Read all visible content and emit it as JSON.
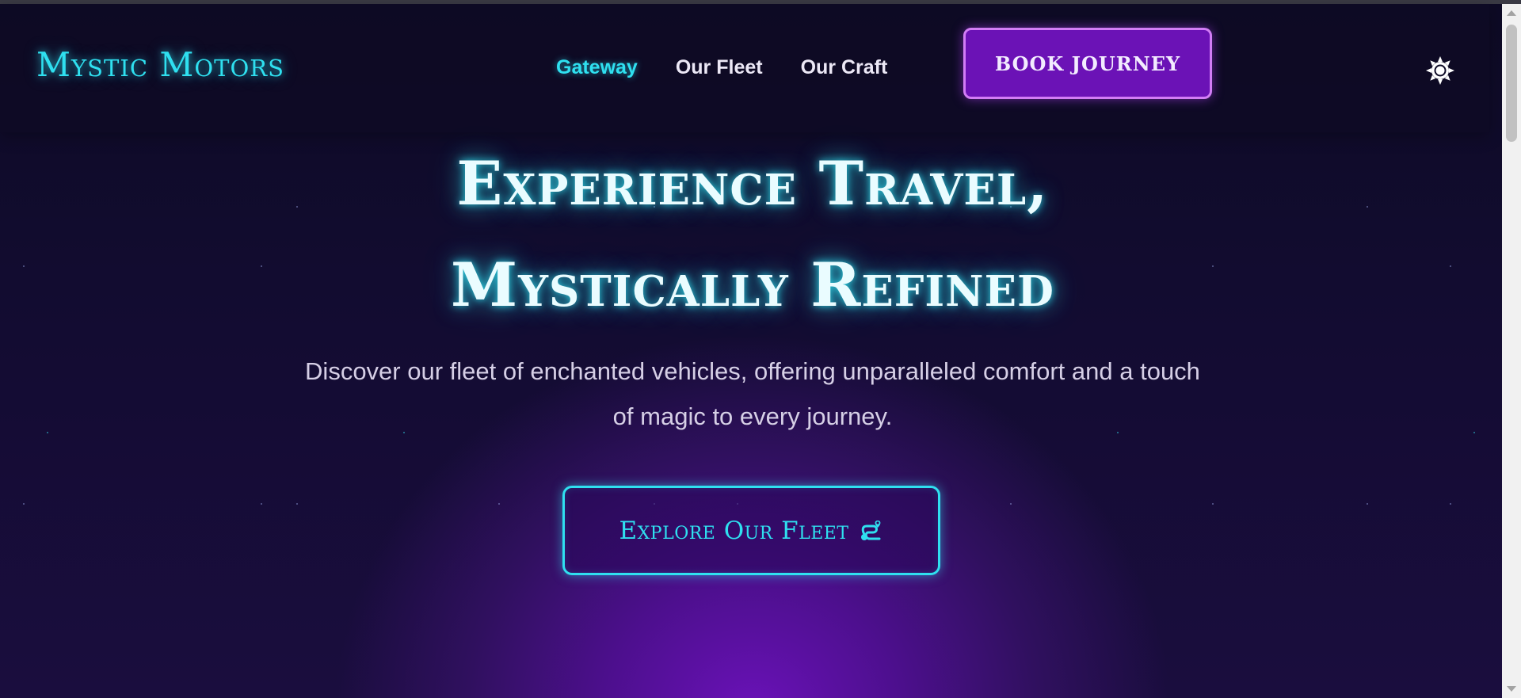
{
  "brand": {
    "name": "Mystic  Motors"
  },
  "nav": {
    "links": [
      {
        "label": "Gateway",
        "active": true
      },
      {
        "label": "Our Fleet",
        "active": false
      },
      {
        "label": "Our Craft",
        "active": false
      }
    ],
    "cta_label": "BOOK JOURNEY",
    "theme_toggle_icon": "sun-icon"
  },
  "hero": {
    "title_line1": "Experience Travel,",
    "title_line2": "Mystically Refined",
    "subtitle": "Discover our fleet of enchanted vehicles, offering unparalleled comfort and a touch of magic to every journey.",
    "cta_label": "Explore Our Fleet",
    "cta_icon": "route-icon"
  },
  "colors": {
    "accent_cyan": "#2fe0f0",
    "accent_purple": "#6b12b6",
    "background": "#0e0b26"
  }
}
